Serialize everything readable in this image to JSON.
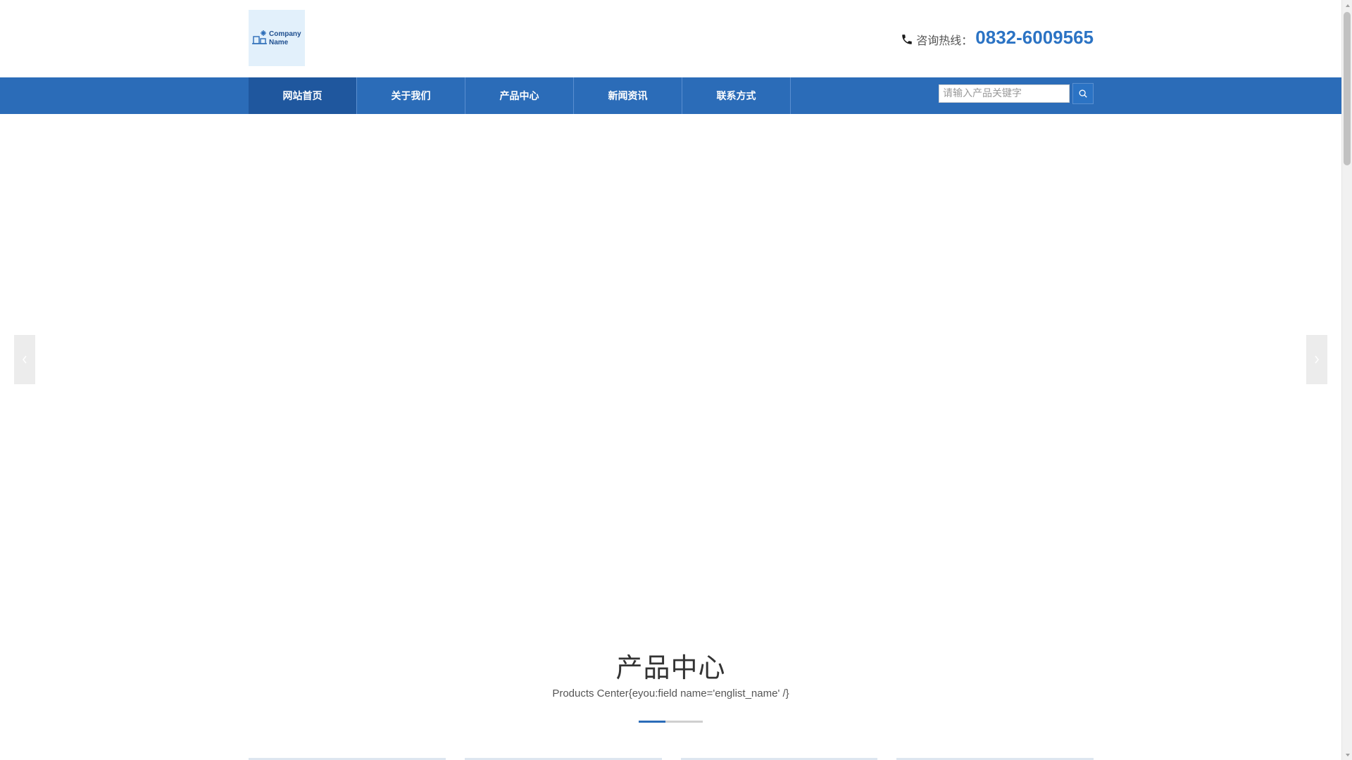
{
  "logo": {
    "text_line1": "Company",
    "text_line2": "Name"
  },
  "hotline": {
    "label": "咨询热线：",
    "number": "0832-6009565"
  },
  "nav": {
    "items": [
      {
        "label": "网站首页",
        "active": true
      },
      {
        "label": "关于我们"
      },
      {
        "label": "产品中心"
      },
      {
        "label": "新闻资讯"
      },
      {
        "label": "联系方式"
      }
    ]
  },
  "search": {
    "placeholder": "请输入产品关键字"
  },
  "section": {
    "title": "产品中心",
    "subtitle": "Products Center{eyou:field name='englist_name' /}"
  },
  "colors": {
    "brand": "#2b6cb8",
    "hotline_number": "#2b73c4",
    "active_nav": "#1f579e"
  }
}
